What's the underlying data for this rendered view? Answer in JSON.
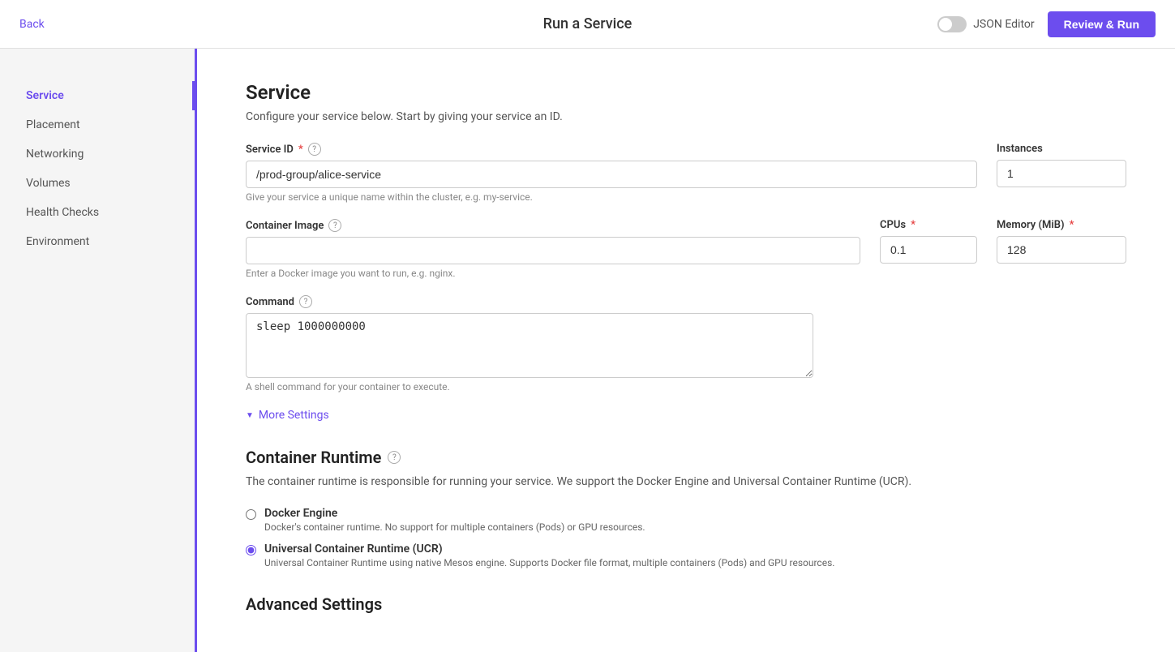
{
  "header": {
    "back_label": "Back",
    "title": "Run a Service",
    "json_editor_label": "JSON Editor",
    "review_btn_label": "Review & Run"
  },
  "sidebar": {
    "items": [
      {
        "id": "service",
        "label": "Service",
        "active": true
      },
      {
        "id": "placement",
        "label": "Placement",
        "active": false
      },
      {
        "id": "networking",
        "label": "Networking",
        "active": false
      },
      {
        "id": "volumes",
        "label": "Volumes",
        "active": false
      },
      {
        "id": "health-checks",
        "label": "Health Checks",
        "active": false
      },
      {
        "id": "environment",
        "label": "Environment",
        "active": false
      }
    ]
  },
  "main": {
    "section_title": "Service",
    "section_desc": "Configure your service below. Start by giving your service an ID.",
    "service_id_label": "Service ID",
    "service_id_value": "/prod-group/alice-service",
    "service_id_hint": "Give your service a unique name within the cluster, e.g. my-service.",
    "instances_label": "Instances",
    "instances_value": "1",
    "container_image_label": "Container Image",
    "container_image_placeholder": "",
    "container_image_hint": "Enter a Docker image you want to run, e.g. nginx.",
    "cpus_label": "CPUs",
    "cpus_value": "0.1",
    "memory_label": "Memory (MiB)",
    "memory_value": "128",
    "command_label": "Command",
    "command_value": "sleep 1000000000",
    "command_hint": "A shell command for your container to execute.",
    "more_settings_label": "More Settings",
    "container_runtime_title": "Container Runtime",
    "container_runtime_desc": "The container runtime is responsible for running your service. We support the Docker Engine and Universal Container Runtime (UCR).",
    "docker_engine_label": "Docker Engine",
    "docker_engine_desc": "Docker's container runtime. No support for multiple containers (Pods) or GPU resources.",
    "ucr_label": "Universal Container Runtime (UCR)",
    "ucr_desc": "Universal Container Runtime using native Mesos engine. Supports Docker file format, multiple containers (Pods) and GPU resources.",
    "advanced_settings_title": "Advanced Settings"
  }
}
